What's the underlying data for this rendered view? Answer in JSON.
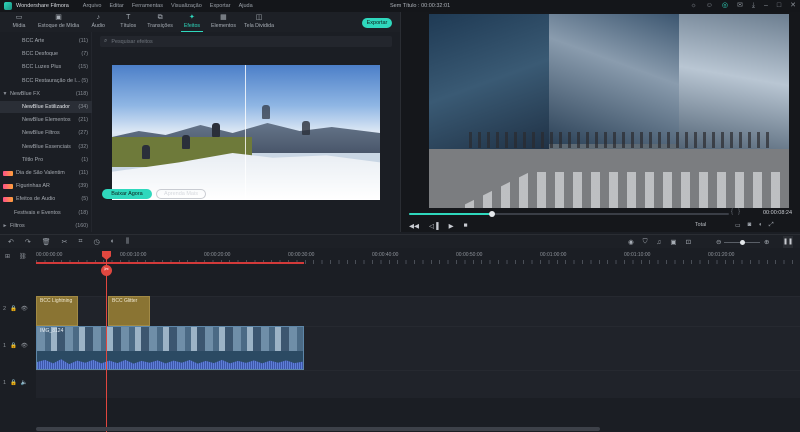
{
  "app": {
    "name": "Wondershare Filmora",
    "window_title": "Sem Título : 00:00:32:01"
  },
  "menu": [
    "Arquivo",
    "Editar",
    "Ferramentas",
    "Visualização",
    "Exportar",
    "Ajuda"
  ],
  "title_icons": [
    "lightbulb-icon",
    "person-icon",
    "headset-icon",
    "mail-icon",
    "download-icon",
    "minimize-icon",
    "maximize-icon",
    "close-icon"
  ],
  "toolbar": {
    "tabs": [
      {
        "label": "Mídia",
        "icon": "folder-icon"
      },
      {
        "label": "Estoque de Mídia",
        "icon": "stock-icon"
      },
      {
        "label": "Áudio",
        "icon": "music-icon"
      },
      {
        "label": "Títulos",
        "icon": "text-icon"
      },
      {
        "label": "Transições",
        "icon": "transition-icon"
      },
      {
        "label": "Efeitos",
        "icon": "effects-icon"
      },
      {
        "label": "Elementos",
        "icon": "elements-icon"
      },
      {
        "label": "Tela Dividida",
        "icon": "split-screen-icon"
      }
    ],
    "active_tab": "Efeitos",
    "export_label": "Exportar"
  },
  "categories": [
    {
      "name": "BCC Arte",
      "count": "(11)",
      "indent": 2
    },
    {
      "name": "BCC Desfoque",
      "count": "(7)",
      "indent": 2
    },
    {
      "name": "BCC Luzes Plus",
      "count": "(15)",
      "indent": 2
    },
    {
      "name": "BCC Restauração de I...",
      "count": "(5)",
      "indent": 2
    },
    {
      "name": "NewBlue FX",
      "count": "(118)",
      "indent": 1,
      "arrow": "▼"
    },
    {
      "name": "NewBlue Estilizador",
      "count": "(34)",
      "indent": 2,
      "selected": true
    },
    {
      "name": "NewBlue Elementos",
      "count": "(21)",
      "indent": 2
    },
    {
      "name": "NewBlue Filtros",
      "count": "(27)",
      "indent": 2
    },
    {
      "name": "NewBlue Essenciais",
      "count": "(32)",
      "indent": 2
    },
    {
      "name": "Tiltlo Pro",
      "count": "(1)",
      "indent": 2
    },
    {
      "name": "Dia de São Valentim",
      "count": "(11)",
      "indent": 0,
      "thumb": true
    },
    {
      "name": "Figurinhas AR",
      "count": "(39)",
      "indent": 0,
      "thumb": true
    },
    {
      "name": "Efeitos de Áudio",
      "count": "(5)",
      "indent": 0,
      "thumb": true
    },
    {
      "name": "Festivais e Eventos",
      "count": "(18)",
      "indent": 1
    },
    {
      "name": "Filtros",
      "count": "(160)",
      "indent": 1,
      "arrow": "►"
    }
  ],
  "browser": {
    "search_placeholder": "Pesquisar efeitos",
    "buy_label": "Baixar Agora",
    "learn_label": "Aprenda Mais"
  },
  "player": {
    "timecode": "00:00:08:24",
    "quality": "Total",
    "progress_fraction": 0.26,
    "controls": [
      "prev-frame-icon",
      "play-back-icon",
      "play-icon",
      "stop-icon"
    ],
    "right_controls": [
      "monitor-icon",
      "camera-icon",
      "volume-icon",
      "fullscreen-icon"
    ]
  },
  "timeline": {
    "ruler_labels": [
      "00:00:00:00",
      "00:00:10:00",
      "00:00:20:00",
      "00:00:30:00",
      "00:00:40:00",
      "00:00:50:00",
      "00:01:00:00",
      "00:01:10:00",
      "00:01:20:00"
    ],
    "tracks": [
      {
        "label": "2",
        "clips": [
          {
            "title": "BCC Lightning"
          },
          {
            "title": "BCC Glitter"
          }
        ]
      },
      {
        "label": "1",
        "clips": [
          {
            "title": "IMG_8124"
          }
        ]
      },
      {
        "label": "1",
        "clips": []
      }
    ],
    "playhead_time_fraction": 0.1
  }
}
